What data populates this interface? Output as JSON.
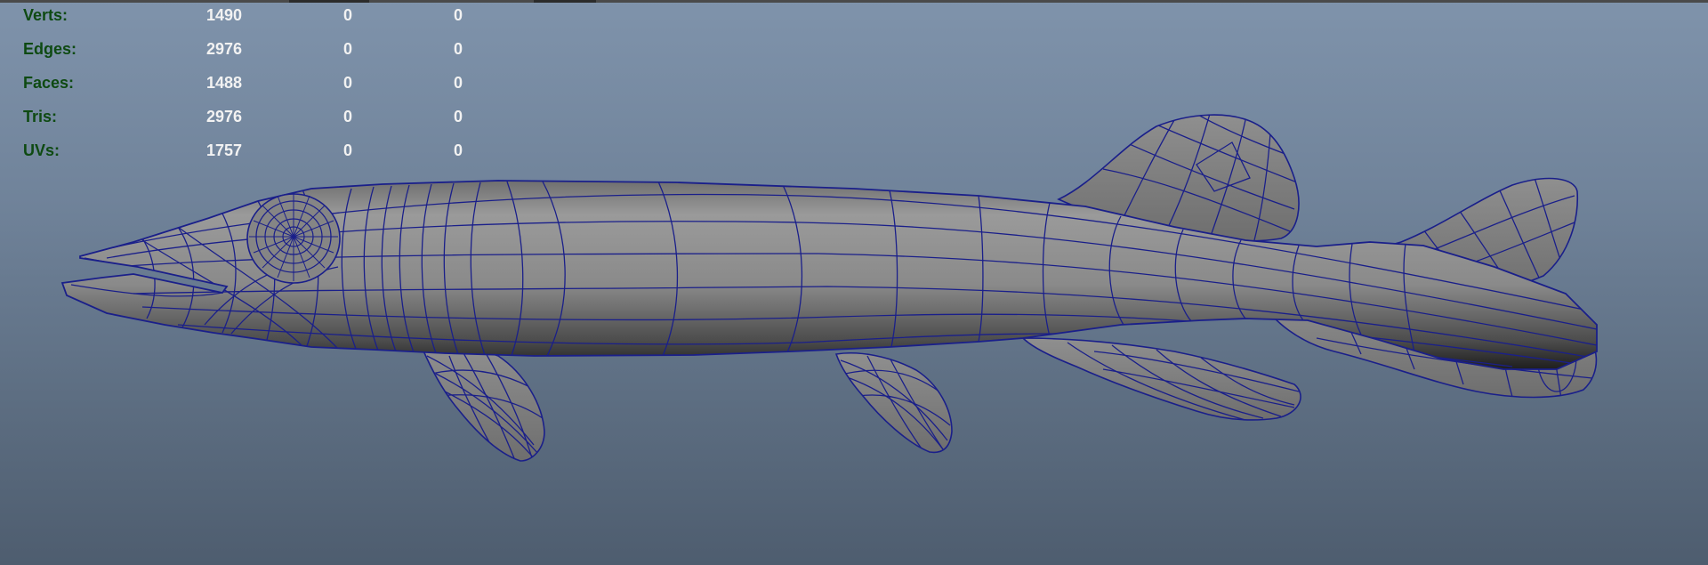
{
  "heads_up_display": {
    "poly_count": [
      {
        "label": "Verts:",
        "values": [
          "1490",
          "0",
          "0"
        ]
      },
      {
        "label": "Edges:",
        "values": [
          "2976",
          "0",
          "0"
        ]
      },
      {
        "label": "Faces:",
        "values": [
          "1488",
          "0",
          "0"
        ]
      },
      {
        "label": "Tris:",
        "values": [
          "2976",
          "0",
          "0"
        ]
      },
      {
        "label": "UVs:",
        "values": [
          "1757",
          "0",
          "0"
        ]
      }
    ]
  },
  "viewport": {
    "background_top": "#7f93ab",
    "background_bottom": "#4e5d6f",
    "wireframe_color": "#1a1f8a",
    "shaded_color": "#8a8a8a",
    "hud_label_color": "#0e4a12",
    "hud_value_color": "#f2f2f2"
  },
  "model": {
    "type": "polygon-mesh",
    "subject": "fish-icon"
  }
}
